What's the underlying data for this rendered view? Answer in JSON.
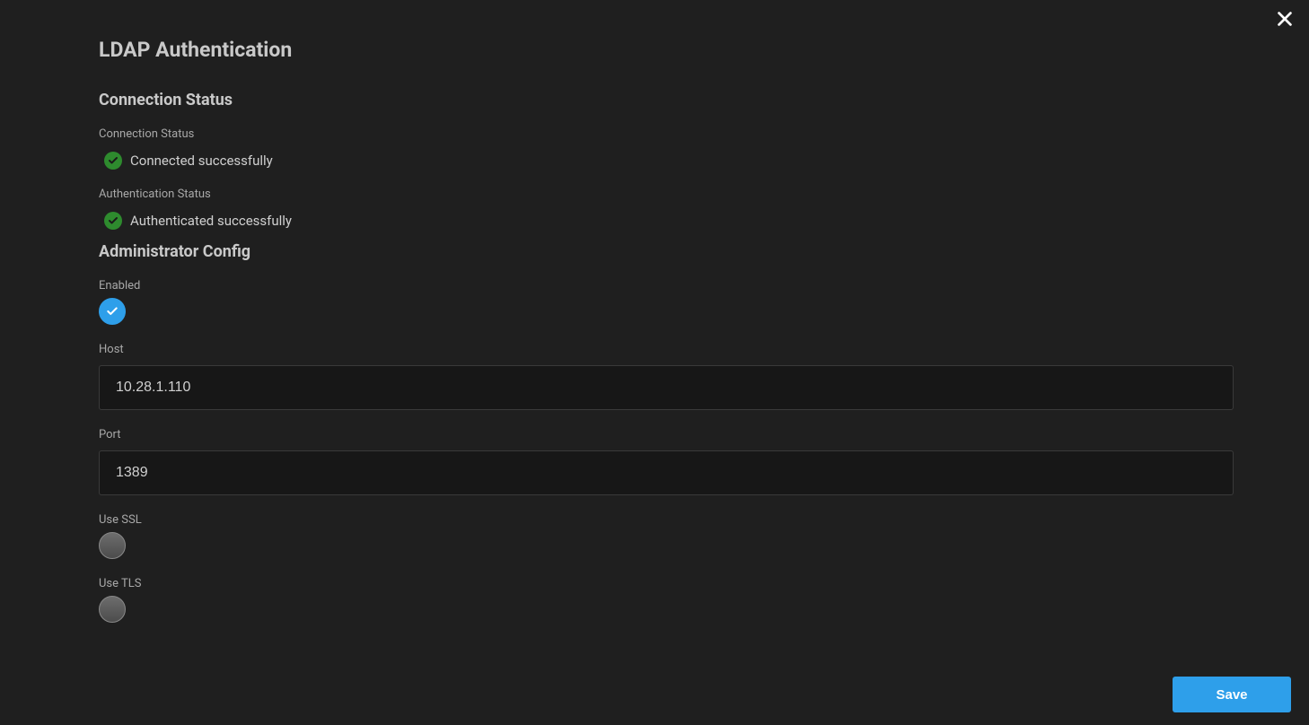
{
  "page": {
    "title": "LDAP Authentication"
  },
  "sections": {
    "connection": {
      "heading": "Connection Status",
      "connStatus": {
        "label": "Connection Status",
        "text": "Connected successfully"
      },
      "authStatus": {
        "label": "Authentication Status",
        "text": "Authenticated successfully"
      }
    },
    "admin": {
      "heading": "Administrator Config",
      "enabled": {
        "label": "Enabled",
        "value": true
      },
      "host": {
        "label": "Host",
        "value": "10.28.1.110"
      },
      "port": {
        "label": "Port",
        "value": "1389"
      },
      "useSsl": {
        "label": "Use SSL",
        "value": false
      },
      "useTls": {
        "label": "Use TLS",
        "value": false
      }
    }
  },
  "footer": {
    "save": "Save"
  },
  "colors": {
    "accent": "#2e9fea",
    "success": "#2e8b2e"
  }
}
